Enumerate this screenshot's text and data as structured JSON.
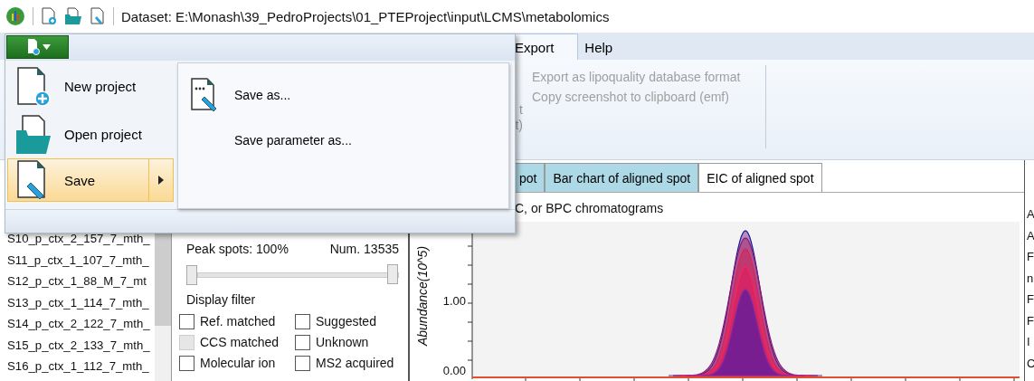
{
  "title_bar": {
    "title": "Dataset: E:\\Monash\\39_PedroProjects\\01_PTEProject\\input\\LCMS\\metabolomics"
  },
  "ribbon_tabs": [
    {
      "label": "Export",
      "selected": true
    },
    {
      "label": "Help",
      "selected": false
    }
  ],
  "ribbon": {
    "cut_items": [
      "t",
      "t)"
    ],
    "items": [
      {
        "label": "Export as lipoquality database format",
        "disabled": true
      },
      {
        "label": "Copy screenshot to clipboard (emf)",
        "disabled": true
      }
    ]
  },
  "file_menu": {
    "items": [
      {
        "label": "New project",
        "kind": "new",
        "selected": false,
        "submenu": false
      },
      {
        "label": "Open project",
        "kind": "open",
        "selected": false,
        "submenu": false
      },
      {
        "label": "Save",
        "kind": "save",
        "selected": true,
        "submenu": true
      }
    ],
    "submenu": [
      {
        "label": "Save as...",
        "kind": "save_as"
      },
      {
        "label": "Save parameter as...",
        "kind": "plain"
      }
    ]
  },
  "file_list": [
    "S10_p_ctx_2_157_7_mth_",
    "S11_p_ctx_1_107_7_mth_",
    "S12_p_ctx_1_88_M_7_mt",
    "S13_p_ctx_1_114_7_mth_",
    "S14_p_ctx_2_122_7_mth_",
    "S15_p_ctx_2_133_7_mth_",
    "S16_p_ctx_1_112_7_mth_"
  ],
  "peak_filter": {
    "label": "Peak spots: 100%",
    "count": "Num. 13535",
    "level": 1,
    "display_filter": "Display filter",
    "checkboxes": [
      {
        "label": "Ref. matched",
        "checked": false,
        "disabled": false
      },
      {
        "label": "Suggested",
        "checked": false,
        "disabled": false
      },
      {
        "label": "CCS matched",
        "checked": false,
        "disabled": true
      },
      {
        "label": "Unknown",
        "checked": false,
        "disabled": false
      },
      {
        "label": "Molecular ion",
        "checked": false,
        "disabled": false
      },
      {
        "label": "MS2 acquired",
        "checked": false,
        "disabled": false
      }
    ]
  },
  "chart_tabs": [
    {
      "label": "pot",
      "selected": false
    },
    {
      "label": "Bar chart of aligned spot",
      "selected": false
    },
    {
      "label": "EIC of aligned spot",
      "selected": true
    }
  ],
  "chart": {
    "title": "C, or BPC chromatograms",
    "ylabel": "Abundance(10^5)",
    "yticks": [
      "1.00",
      "0.00"
    ]
  },
  "side_panel": [
    "A",
    "A",
    "F",
    "n",
    "F",
    "F",
    "I",
    "C"
  ]
}
